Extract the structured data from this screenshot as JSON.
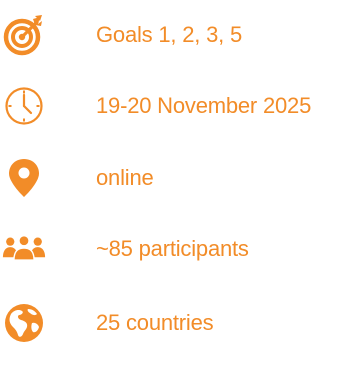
{
  "theme": {
    "accent_color": "#f28c28"
  },
  "items": [
    {
      "icon": "target-icon",
      "label": "Goals 1, 2, 3, 5"
    },
    {
      "icon": "clock-icon",
      "label": "19-20 November 2025"
    },
    {
      "icon": "location-pin-icon",
      "label": "online"
    },
    {
      "icon": "people-icon",
      "label": "~85 participants"
    },
    {
      "icon": "globe-icon",
      "label": "25 countries"
    }
  ]
}
